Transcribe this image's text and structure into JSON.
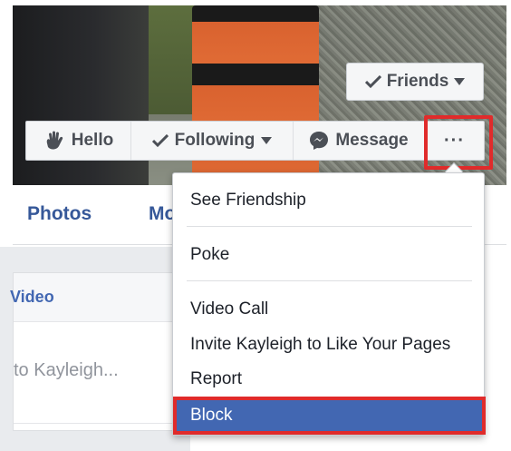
{
  "cover": {
    "friends_button": {
      "label": "Friends"
    }
  },
  "action_bar": {
    "hello": "Hello",
    "following": "Following",
    "message": "Message",
    "more": "···"
  },
  "tabs": {
    "photos": "Photos",
    "more": "Mo"
  },
  "composer": {
    "video_label": "Video",
    "prompt": "to Kayleigh..."
  },
  "menu": {
    "items": [
      {
        "label": "See Friendship"
      },
      {
        "label": "Poke"
      },
      {
        "label": "Video Call"
      },
      {
        "label": "Invite Kayleigh to Like Your Pages"
      },
      {
        "label": "Report"
      },
      {
        "label": "Block"
      }
    ]
  },
  "colors": {
    "link_blue": "#365899",
    "menu_selected": "#4267b2",
    "highlight_red": "#e02b2b"
  }
}
